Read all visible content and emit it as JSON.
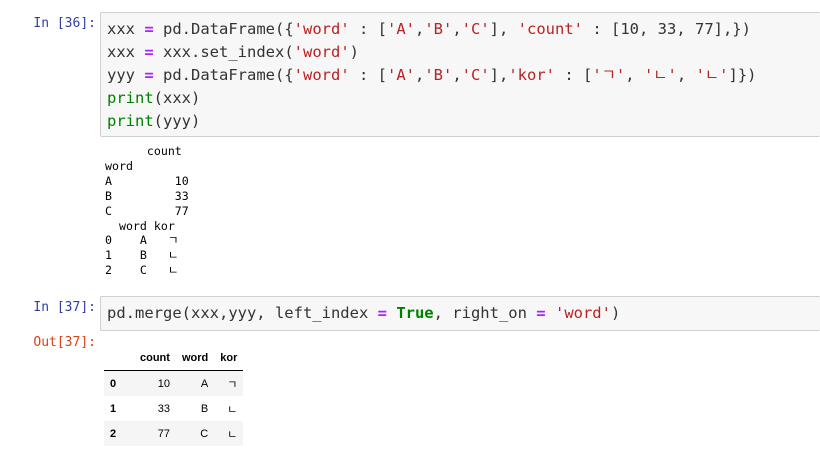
{
  "cells": [
    {
      "prompt": "In [36]:",
      "stdout": "      count\nword\nA         10\nB         33\nC         77\n  word kor\n0    A   ㄱ\n1    B   ㄴ\n2    C   ㄴ"
    },
    {
      "prompt": "In [37]:",
      "out_prompt": "Out[37]:",
      "table": {
        "columns": [
          "count",
          "word",
          "kor"
        ],
        "rows": [
          {
            "index": "0",
            "count": "10",
            "word": "A",
            "kor": "ㄱ"
          },
          {
            "index": "1",
            "count": "33",
            "word": "B",
            "kor": "ㄴ"
          },
          {
            "index": "2",
            "count": "77",
            "word": "C",
            "kor": "ㄴ"
          }
        ]
      }
    }
  ],
  "code": {
    "cell1": [
      [
        "xxx ",
        "=",
        " pd.DataFrame({",
        "'word'",
        " : [",
        "'A'",
        ",",
        "'B'",
        ",",
        "'C'",
        "], ",
        "'count'",
        " : [10, 33, 77],})"
      ],
      [
        "xxx ",
        "=",
        " xxx.set_index(",
        "'word'",
        ")"
      ],
      [
        "yyy ",
        "=",
        " pd.DataFrame({",
        "'word'",
        " : [",
        "'A'",
        ",",
        "'B'",
        ",",
        "'C'",
        "],",
        "'kor'",
        " : [",
        "'ㄱ'",
        ", ",
        "'ㄴ'",
        ", ",
        "'ㄴ'",
        "]})"
      ],
      [
        "print",
        "(xxx)"
      ],
      [
        "print",
        "(yyy)"
      ]
    ],
    "cell2": [
      [
        "pd.merge(xxx,yyy, left_index ",
        "=",
        " ",
        "True",
        ", right_on ",
        "=",
        " ",
        "'word'",
        ")"
      ]
    ]
  }
}
